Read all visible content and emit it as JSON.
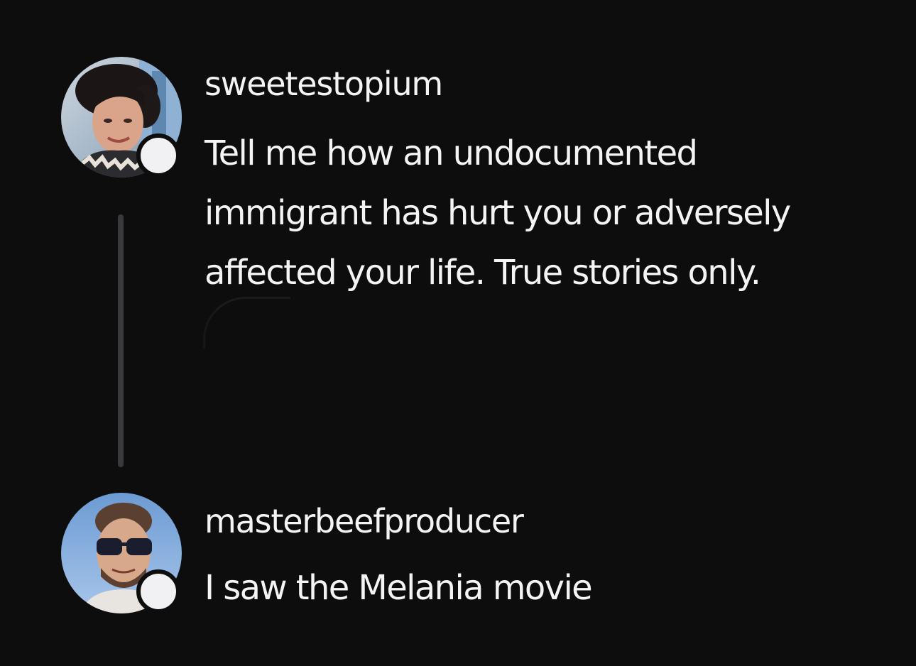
{
  "posts": [
    {
      "username": "sweetestopium",
      "text_lines": [
        "Tell me how an undocumented",
        "immigrant has hurt you or adversely",
        "affected your life. True stories only."
      ]
    },
    {
      "username": "masterbeefproducer",
      "text_lines": [
        "I saw the Melania movie"
      ]
    }
  ],
  "colors": {
    "background": "#0d0d0e",
    "text": "#f4f4f4",
    "thread_line": "#3a3a3d",
    "badge": "#f1f1f3"
  },
  "icons": [
    "avatar-sweetestopium",
    "avatar-masterbeefproducer",
    "status-badge"
  ]
}
